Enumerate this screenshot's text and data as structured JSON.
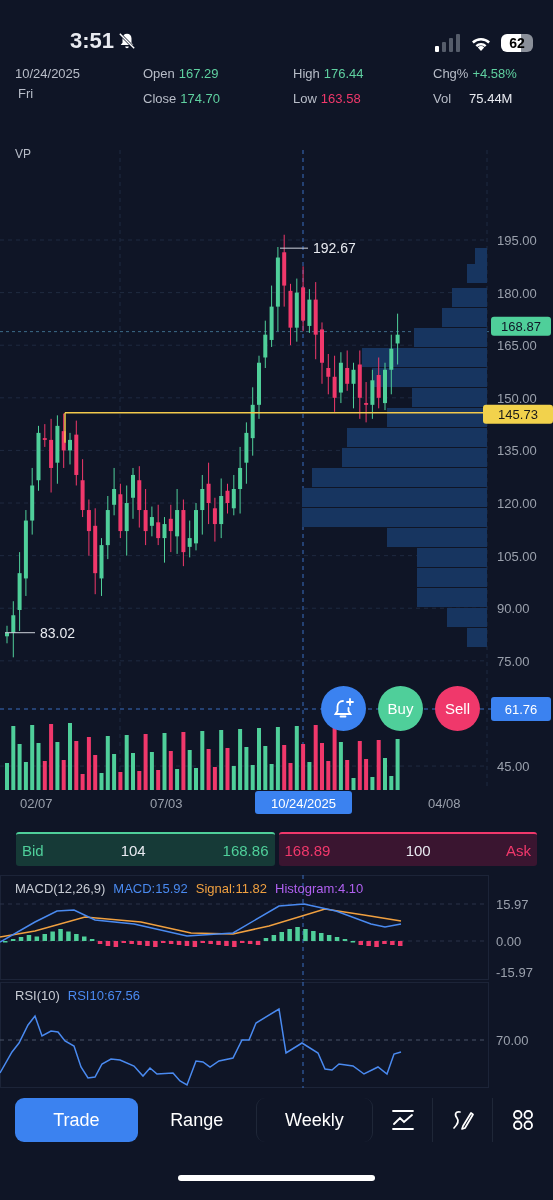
{
  "status_bar": {
    "time": "3:51",
    "battery": "62"
  },
  "quote": {
    "date": "10/24/2025",
    "weekday": "Fri",
    "stats": [
      {
        "label": "Open",
        "value": "167.29",
        "color": "#5fd0a0"
      },
      {
        "label": "Close",
        "value": "174.70",
        "color": "#5fd0a0"
      },
      {
        "label": "High",
        "value": "176.44",
        "color": "#5fd0a0"
      },
      {
        "label": "Low",
        "value": "163.58",
        "color": "#f0386b"
      },
      {
        "label": "Chg%",
        "value": "+4.58%",
        "color": "#5fd0a0"
      },
      {
        "label": "Vol",
        "value": "75.44M",
        "color": "#e8eaf0"
      }
    ]
  },
  "chart": {
    "indicator": "VP",
    "y_ticks": [
      "195.00",
      "180.00",
      "165.00",
      "150.00",
      "135.00",
      "120.00",
      "105.00",
      "90.00",
      "75.00",
      "45.00"
    ],
    "x_labels": [
      "02/07",
      "07/03",
      "04/08"
    ],
    "cursor_date": "10/24/2025",
    "cursor_price": "61.76",
    "last_price": "168.87",
    "level_price": "145.73",
    "high_marker": "192.67",
    "low_marker": "83.02"
  },
  "actions": [
    {
      "kind": "alert"
    },
    {
      "kind": "buy",
      "label": "Buy"
    },
    {
      "kind": "sell",
      "label": "Sell"
    }
  ],
  "order_book": {
    "bid": {
      "label": "Bid",
      "size": "104",
      "price": "168.86"
    },
    "ask": {
      "price": "168.89",
      "size": "100",
      "label": "Ask"
    }
  },
  "macd": {
    "title": "MACD(12,26,9)",
    "values": [
      {
        "text": "MACD:15.92",
        "color": "#4a8af0"
      },
      {
        "text": "Signal:11.82",
        "color": "#f0a040"
      },
      {
        "text": "Histogram:4.10",
        "color": "#b060f0"
      }
    ],
    "y_ticks": [
      "15.97",
      "0.00",
      "-15.97"
    ]
  },
  "rsi": {
    "title": "RSI(10)",
    "value": "RSI10:67.56",
    "y_tick": "70.00"
  },
  "toolbar": [
    {
      "kind": "tab",
      "label": "Trade",
      "selected": true
    },
    {
      "kind": "tab",
      "label": "Range",
      "selected": false
    },
    {
      "kind": "tab",
      "label": "Weekly",
      "selected": false
    },
    {
      "kind": "indicator"
    },
    {
      "kind": "draw"
    },
    {
      "kind": "more"
    }
  ]
}
